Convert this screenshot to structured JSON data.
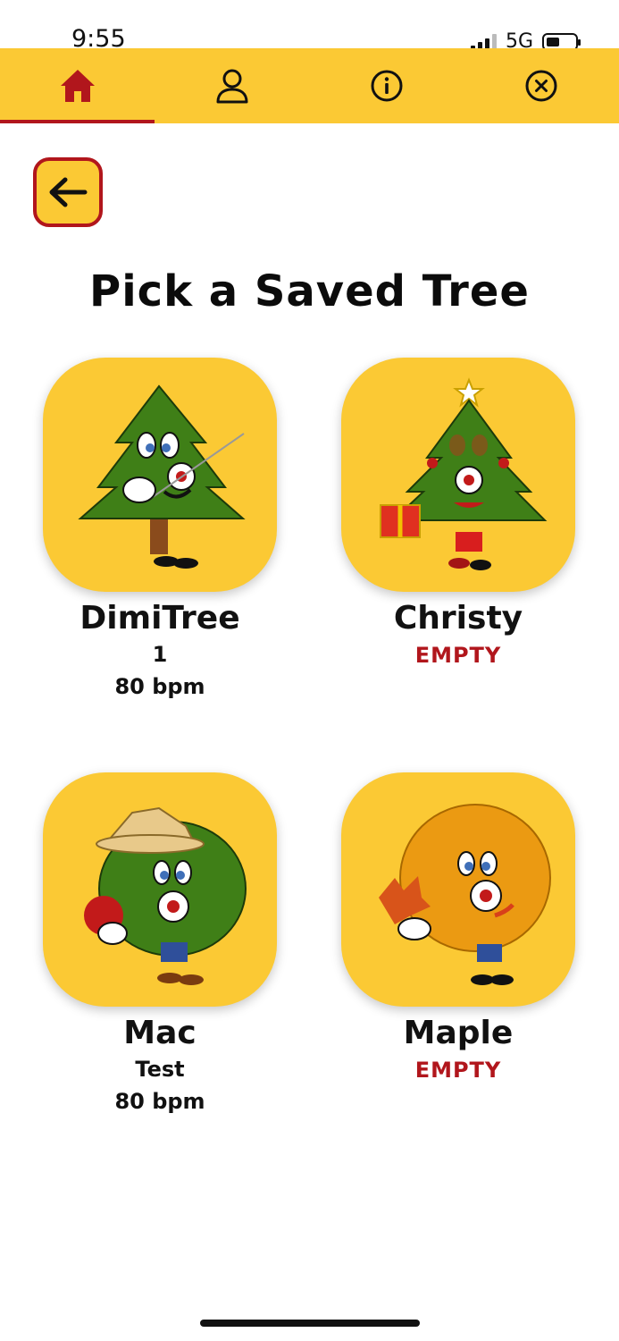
{
  "status_bar": {
    "time": "9:55",
    "network": "5G"
  },
  "nav": {
    "tabs": [
      {
        "icon": "home-icon",
        "active": true
      },
      {
        "icon": "profile-icon",
        "active": false
      },
      {
        "icon": "info-icon",
        "active": false
      },
      {
        "icon": "close-circle-icon",
        "active": false
      }
    ]
  },
  "back_button": {
    "icon": "arrow-left-icon"
  },
  "title": "Pick a Saved Tree",
  "trees": [
    {
      "name": "DimiTree",
      "line1": "1",
      "line2": "80 bpm",
      "empty": ""
    },
    {
      "name": "Christy",
      "line1": "",
      "line2": "",
      "empty": "EMPTY"
    },
    {
      "name": "Mac",
      "line1": "Test",
      "line2": "80 bpm",
      "empty": ""
    },
    {
      "name": "Maple",
      "line1": "",
      "line2": "",
      "empty": "EMPTY"
    }
  ],
  "colors": {
    "accent": "#fbc934",
    "brand_red": "#b1161c"
  }
}
